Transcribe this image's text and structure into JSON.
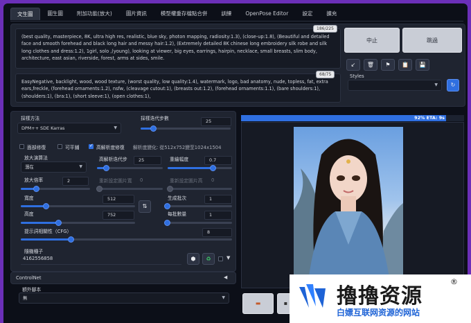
{
  "tabs": [
    "文生圖",
    "圖生圖",
    "附加功能(放大)",
    "圖片資訊",
    "模型權重存檔點合併",
    "訓練",
    "OpenPose Editor",
    "設定",
    "擴充"
  ],
  "prompt": {
    "text": "(best quality, masterpiece, 8K, ultra high res, realistic, blue sky, photon mapping, radiosity:1.3), (close-up:1.8), (Beautiful and detailed face and smooth forehead and black long hair and messy hair:1.2), (Extremely detailed 8K chinese long embroidery silk robe and silk long clothes and dress:1.2), 1girl, solo ,(young), looking at viewer, big eyes, earrings, hairpin, necklace, small breasts, slim body, architecture, east asian, riverside, forest, arms at sides, smile.",
    "counter": "186/225"
  },
  "negative": {
    "text": "EasyNegative, backlight, wood, wood texture, (worst quality, low quality:1.4), watermark, logo, bad anatomy, nude, topless, fat, extra ears,freckle, (forehead ornaments:1.2), nsfw, (cleavage cutout:1), (breasts out:1.2), (forehead ornaments:1.1), (bare shoulders:1), (shoulders:1), (bra:1), (short sleeve:1), (open clothes:1),",
    "counter": "68/75"
  },
  "actions": {
    "interrupt": "中止",
    "skip": "跳過"
  },
  "tools": {
    "apply": "↙",
    "trash": "🗑",
    "flag": "⚑",
    "paste": "📋",
    "save": "💾"
  },
  "styles": {
    "label": "Styles",
    "refresh": "↻"
  },
  "params": {
    "sampler_label": "採樣方法",
    "sampler_value": "DPM++ SDE Karras",
    "steps_label": "採樣迭代步數",
    "steps_value": "25",
    "restore_faces": "面部修復",
    "tiling": "可平鋪",
    "hires_fix": "高解析度修復",
    "hires_info": "解析度變化: 從512x752變至1024x1504",
    "upscaler_label": "放大演算法",
    "upscaler_value": "潛在",
    "hires_steps_label": "高解析迭代步",
    "hires_steps_value": "25",
    "denoise_label": "重繪幅度",
    "denoise_value": "0.7",
    "upscale_by_label": "放大倍率",
    "upscale_by_value": "2",
    "resize_w_label": "重新設定圖片寬",
    "resize_w_value": "0",
    "resize_h_label": "重新設定圖片高",
    "resize_h_value": "0",
    "width_label": "寬度",
    "width_value": "512",
    "height_label": "高度",
    "height_value": "752",
    "swap_icon": "⇅",
    "batch_count_label": "生成批次",
    "batch_count_value": "1",
    "batch_size_label": "每批數量",
    "batch_size_value": "1",
    "cfg_label": "提示詞相關性（CFG）",
    "cfg_value": "8",
    "seed_label": "隨機種子",
    "seed_value": "4162556858",
    "controlnet_label": "ControlNet",
    "script_label": "額外腳本",
    "script_value": "無"
  },
  "progress": {
    "text": "92% ETA: 9s",
    "fraction": 0.92
  },
  "watermark": {
    "title": "擼擼资源",
    "subtitle": "白嫖互联网资源的网站",
    "reg": "®"
  },
  "colors": {
    "accent": "#2f6fe0",
    "page_bg": "#0c0f18",
    "frame": "#6b2fb8"
  }
}
